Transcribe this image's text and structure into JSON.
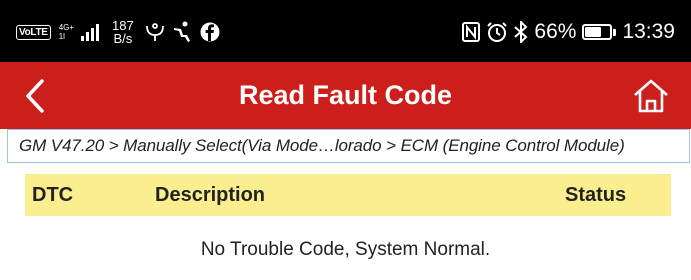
{
  "status_bar": {
    "volte": "VoLTE",
    "network": "4G+",
    "network_sub": "1l",
    "speed_value": "187",
    "speed_unit": "B/s",
    "battery": "66%",
    "battery_level": 0.66,
    "time": "13:39",
    "icons": [
      "usb-icon",
      "accessibility-icon",
      "facebook-icon",
      "nfc-icon",
      "alarm-icon",
      "bluetooth-icon"
    ]
  },
  "header": {
    "title": "Read Fault Code",
    "background_color": "#cc1f1c",
    "back_icon": "chevron-left-icon",
    "home_icon": "home-icon"
  },
  "breadcrumb": {
    "text": "GM V47.20 > Manually Select(Via Mode…lorado > ECM (Engine Control Module)"
  },
  "table": {
    "columns": [
      "DTC",
      "Description",
      "Status"
    ],
    "header_color": "#fbee8e",
    "rows": [],
    "empty_message": "No Trouble Code, System Normal."
  }
}
